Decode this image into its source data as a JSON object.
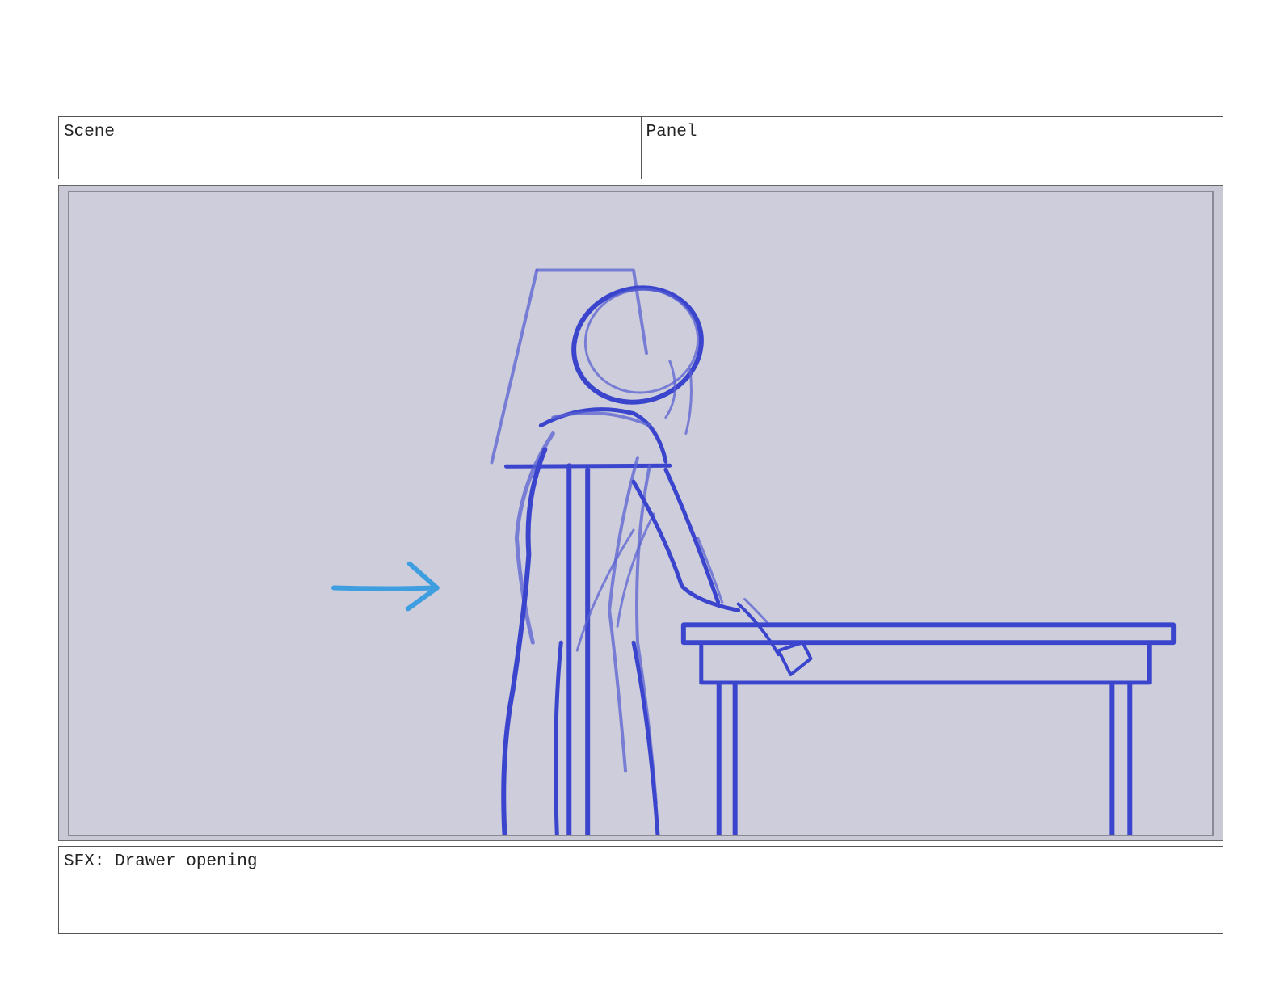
{
  "header": {
    "scene_label": "Scene",
    "panel_label": "Panel"
  },
  "frame": {
    "background_color": "#cdcddb",
    "sketch_color": "#3a44cc",
    "arrow_color": "#3f9ee0",
    "elements": [
      "figure-sketch",
      "chair-sketch",
      "table-sketch",
      "movement-arrow"
    ]
  },
  "caption": {
    "text": "SFX: Drawer opening"
  }
}
